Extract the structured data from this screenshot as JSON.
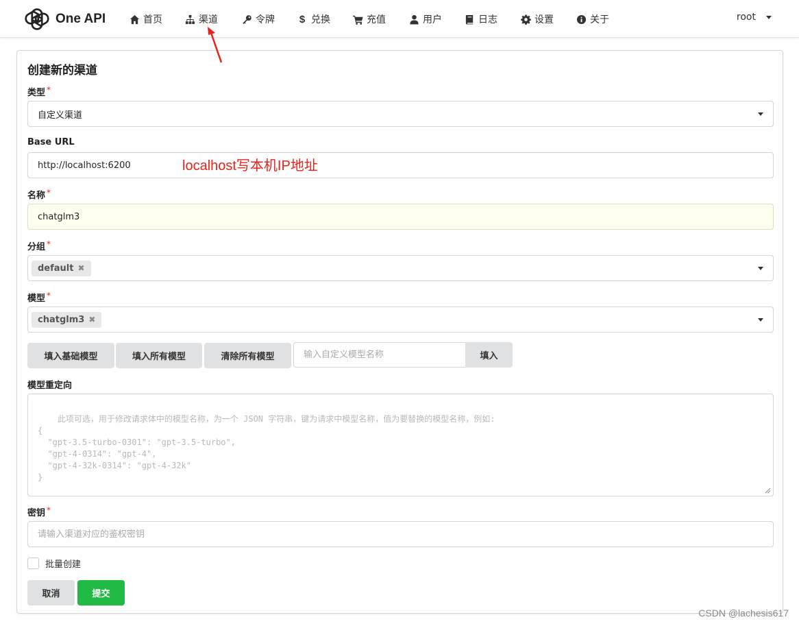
{
  "nav": {
    "brand": "One API",
    "items": [
      {
        "label": "首页",
        "icon": "home-icon"
      },
      {
        "label": "渠道",
        "icon": "sitemap-icon"
      },
      {
        "label": "令牌",
        "icon": "key-icon"
      },
      {
        "label": "兑换",
        "icon": "dollar-icon"
      },
      {
        "label": "充值",
        "icon": "cart-icon"
      },
      {
        "label": "用户",
        "icon": "user-icon"
      },
      {
        "label": "日志",
        "icon": "book-icon"
      },
      {
        "label": "设置",
        "icon": "gear-icon"
      },
      {
        "label": "关于",
        "icon": "info-icon"
      }
    ],
    "user": "root"
  },
  "annotation": {
    "text": "localhost写本机IP地址",
    "color": "#e8231b"
  },
  "form": {
    "title": "创建新的渠道",
    "type": {
      "label": "类型",
      "value": "自定义渠道"
    },
    "base_url": {
      "label": "Base URL",
      "value": "http://localhost:6200"
    },
    "name": {
      "label": "名称",
      "value": "chatglm3"
    },
    "group": {
      "label": "分组",
      "chips": [
        "default"
      ]
    },
    "models": {
      "label": "模型",
      "chips": [
        "chatglm3"
      ]
    },
    "model_buttons": {
      "fill_basic": "填入基础模型",
      "fill_all": "填入所有模型",
      "clear_all": "清除所有模型",
      "custom_placeholder": "输入自定义模型名称",
      "fill": "填入"
    },
    "model_mapping": {
      "label": "模型重定向",
      "placeholder": "此项可选，用于修改请求体中的模型名称，为一个 JSON 字符串，键为请求中模型名称，值为要替换的模型名称，例如:\n{\n  \"gpt-3.5-turbo-0301\": \"gpt-3.5-turbo\",\n  \"gpt-4-0314\": \"gpt-4\",\n  \"gpt-4-32k-0314\": \"gpt-4-32k\"\n}"
    },
    "key": {
      "label": "密钥",
      "placeholder": "请输入渠道对应的鉴权密钥"
    },
    "batch_create": {
      "label": "批量创建",
      "checked": false
    },
    "cancel": "取消",
    "submit": "提交"
  },
  "colors": {
    "submit": "#21ba45",
    "required": "#db2828"
  },
  "watermark": "CSDN @lachesis617"
}
